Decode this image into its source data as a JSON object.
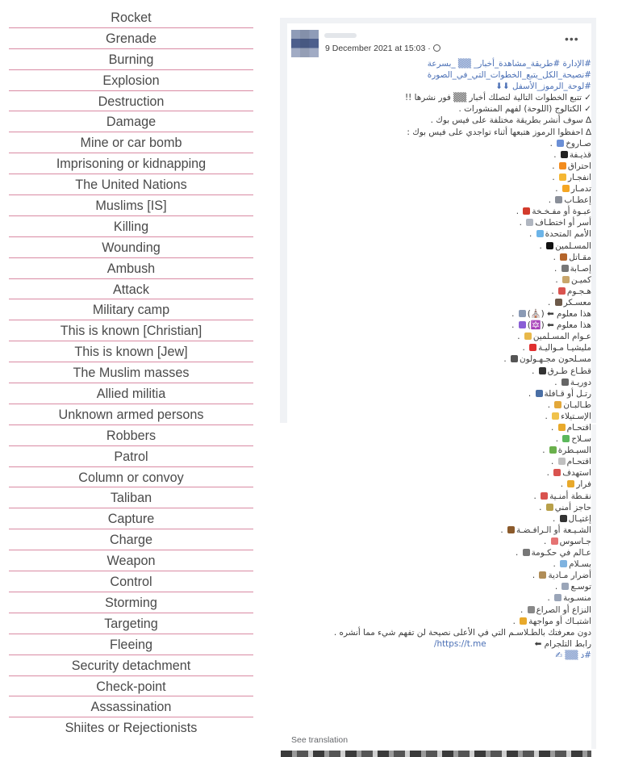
{
  "glossary": {
    "items": [
      "Rocket",
      "Grenade",
      "Burning",
      "Explosion",
      "Destruction",
      "Damage",
      "Mine or car bomb",
      "Imprisoning or kidnapping",
      "The United Nations",
      "Muslims [IS]",
      "Killing",
      "Wounding",
      "Ambush",
      "Attack",
      "Military camp",
      "This is known [Christian]",
      "This is known [Jew]",
      "The Muslim masses",
      "Allied militia",
      "Unknown armed persons",
      "Robbers",
      "Patrol",
      "Column or convoy",
      "Taliban",
      "Capture",
      "Charge",
      "Weapon",
      "Control",
      "Storming",
      "Targeting",
      "Fleeing",
      "Security detachment",
      "Check-point",
      "Assassination",
      "Shiites or Rejectionists"
    ]
  },
  "post": {
    "date": "9 December 2021 at 15:03 ·",
    "more_label": "•••",
    "see_translation": "See translation",
    "link": "https://t.me/",
    "header_lines": [
      {
        "text": "#الإدارة #طريقة_مشاهدة_أخبار_ ▒▒ _بسرعة",
        "hash": true
      },
      {
        "text": "#نصيحة_الكل_يتبع_الخطوات_التي_في_الصورة",
        "hash": true
      },
      {
        "text": "#لوحة_الرموز_الأسفل ⬇⬇",
        "hash": true
      },
      {
        "text": "✓ تتبع الخطوات التالية لتصلك أخبار ▒▒ فور نشرها !!",
        "hash": false
      },
      {
        "text": "✓ الكتالوج (اللوحة) لفهم المنشورات .",
        "hash": false
      },
      {
        "text": "∆ سوف أنشر بطريقة مختلفة على فيس بوك .",
        "hash": false
      },
      {
        "text": "∆ احفظوا الرموز هتبعها أثناء تواجدي على فيس بوك :",
        "hash": false
      }
    ],
    "symbol_lines": [
      {
        "text": "صـاروخ",
        "emoji_color": "#6b8fd6"
      },
      {
        "text": "قذيـفة",
        "emoji_color": "#222222"
      },
      {
        "text": "احتراق",
        "emoji_color": "#f28c1e"
      },
      {
        "text": "انفجـار",
        "emoji_color": "#f5b733"
      },
      {
        "text": "تدمـار",
        "emoji_color": "#f5a623"
      },
      {
        "text": "إعطـاب",
        "emoji_color": "#8a8f99"
      },
      {
        "text": "عبـوة أو مفـخـخة",
        "emoji_color": "#d33b2c"
      },
      {
        "text": "أسر أو اختطـاف",
        "emoji_color": "#b0b6c0"
      },
      {
        "text": "الأمم المتحدة",
        "emoji_color": "#6cb4e8"
      },
      {
        "text": "المسـلمين",
        "emoji_color": "#111111"
      },
      {
        "text": "مقـاتل",
        "emoji_color": "#b5652b"
      },
      {
        "text": "إصـابة",
        "emoji_color": "#777777"
      },
      {
        "text": "كميـن",
        "emoji_color": "#c9a66b"
      },
      {
        "text": "هـجـوم",
        "emoji_color": "#d9534f"
      },
      {
        "text": "معسـكر",
        "emoji_color": "#6d5a4a"
      },
      {
        "text": "هذا معلوم ⬅ (⛪)",
        "emoji_color": "#8a9ab5"
      },
      {
        "text": "هذا معلوم ⬅ (🔯)",
        "emoji_color": "#8a5fd6"
      },
      {
        "text": "عـوام المسـلمين",
        "emoji_color": "#e8b84a"
      },
      {
        "text": "مليشيـا مـواليـة",
        "emoji_color": "#e03030"
      },
      {
        "text": "مسـلحون مجـهـولون",
        "emoji_color": "#555555"
      },
      {
        "text": "قطـاع طـرق",
        "emoji_color": "#333333"
      },
      {
        "text": "دوريـة",
        "emoji_color": "#666666"
      },
      {
        "text": "رتـل أو قـافلة",
        "emoji_color": "#4a6fa5"
      },
      {
        "text": "طـالبـان",
        "emoji_color": "#e3a83a"
      },
      {
        "text": "الإسـتيلاء",
        "emoji_color": "#f0c24b"
      },
      {
        "text": "اقتحـام",
        "emoji_color": "#e8a92b"
      },
      {
        "text": "سـلاح",
        "emoji_color": "#5cb85c"
      },
      {
        "text": "السيـطرة",
        "emoji_color": "#6ab04c"
      },
      {
        "text": "اقتحـام",
        "emoji_color": "#c0c0c0"
      },
      {
        "text": "استهدف",
        "emoji_color": "#d9534f"
      },
      {
        "text": "فرار",
        "emoji_color": "#e8a92b"
      },
      {
        "text": "نقـطة أمنـية",
        "emoji_color": "#d9534f"
      },
      {
        "text": "حاجز أمني",
        "emoji_color": "#b8a04a"
      },
      {
        "text": "إغتيـال",
        "emoji_color": "#333333"
      },
      {
        "text": "الشـيـعة أو الـرافـضـة",
        "emoji_color": "#8b5a2b"
      },
      {
        "text": "جـاسوس",
        "emoji_color": "#e57373"
      },
      {
        "text": "عـالم في حكـومة",
        "emoji_color": "#777777"
      },
      {
        "text": "بسـلام",
        "emoji_color": "#7fb3e0"
      },
      {
        "text": "أضرار مـادية",
        "emoji_color": "#b08d57"
      },
      {
        "text": "توسـع",
        "emoji_color": "#9aa5b8"
      },
      {
        "text": "منسـوبة",
        "emoji_color": "#9aa5b8"
      },
      {
        "text": "النزاع أو الصراع",
        "emoji_color": "#888888"
      },
      {
        "text": "اشتبـاك أو مواجهة",
        "emoji_color": "#e8a92b"
      }
    ],
    "footer_line": "دون معرفتك بالطـلاسـم التي في الأعلى نصيحة لن تفهم شيء مما أنشره .",
    "telegram_label": "رابط التلجرام ⬅",
    "signature": "#د ▒▒ ✍"
  }
}
